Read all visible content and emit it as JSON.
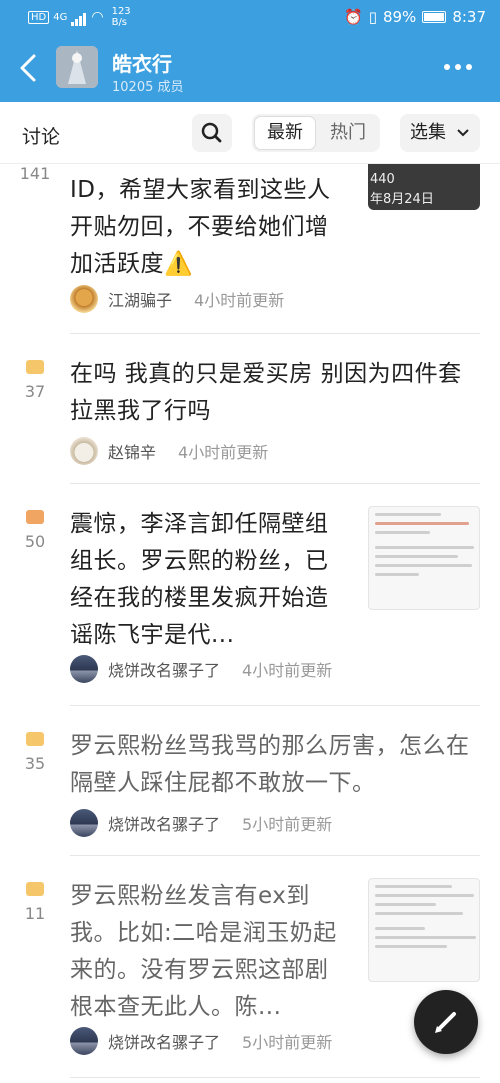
{
  "status_bar": {
    "network": "4G",
    "speed_value": "123",
    "speed_unit": "B/s",
    "battery": "89%",
    "time": "8:37"
  },
  "header": {
    "group_name": "皓衣行",
    "member_count": "10205 成员",
    "back_icon": "chevron-left-icon",
    "more_icon": "more-dots-icon"
  },
  "tabs": {
    "title": "讨论",
    "search_icon": "search-icon",
    "sort_newest": "最新",
    "sort_hot": "热门",
    "filter": "选集"
  },
  "posts": [
    {
      "count": "141",
      "title": "ID，希望大家看到这些人开贴勿回，不要给她们增加活跃度⚠️",
      "author": "江湖骗子",
      "time": "4小时前更新",
      "thumb_caption_1": "440",
      "thumb_caption_2": "年8月24日"
    },
    {
      "count": "37",
      "title": "在吗 我真的只是爱买房 别因为四件套拉黑我了行吗",
      "author": "赵锦辛",
      "time": "4小时前更新"
    },
    {
      "count": "50",
      "title": "震惊，李泽言卸任隔壁组组长。罗云熙的粉丝，已经在我的楼里发疯开始造谣陈飞宇是代...",
      "author": "烧饼改名骡子了",
      "time": "4小时前更新"
    },
    {
      "count": "35",
      "title": "罗云熙粉丝骂我骂的那么厉害，怎么在隔壁人踩住屁都不敢放一下。",
      "author": "烧饼改名骡子了",
      "time": "5小时前更新"
    },
    {
      "count": "11",
      "title": "罗云熙粉丝发言有ex到我。比如:二哈是润玉奶起来的。没有罗云熙这部剧根本查无此人。陈...",
      "author": "烧饼改名骡子了",
      "time": "5小时前更新"
    }
  ],
  "colors": {
    "header_bg": "#3c9fe0",
    "bubble_unread": "#f0a662",
    "bubble_read": "#f5c76a",
    "fab_bg": "#222222"
  },
  "fab_icon": "pencil-icon"
}
